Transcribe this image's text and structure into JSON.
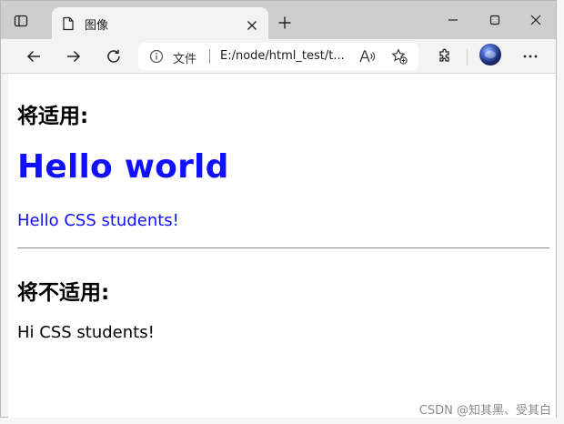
{
  "browser": {
    "tab": {
      "title": "图像",
      "close_icon": "close-icon"
    },
    "toolbar": {
      "address_label": "文件",
      "address_url": "E:/node/html_test/t..."
    }
  },
  "page": {
    "heading_applies": "将适用:",
    "heading_hello": "Hello world",
    "paragraph_hello": "Hello CSS students!",
    "heading_not_applies": "将不适用:",
    "paragraph_hi": "Hi CSS students!"
  },
  "watermark": "CSDN @知其黑、受其白",
  "colors": {
    "blue_text": "#1010ff",
    "tab_strip": "#cecece",
    "toolbar": "#f3f3f3"
  }
}
